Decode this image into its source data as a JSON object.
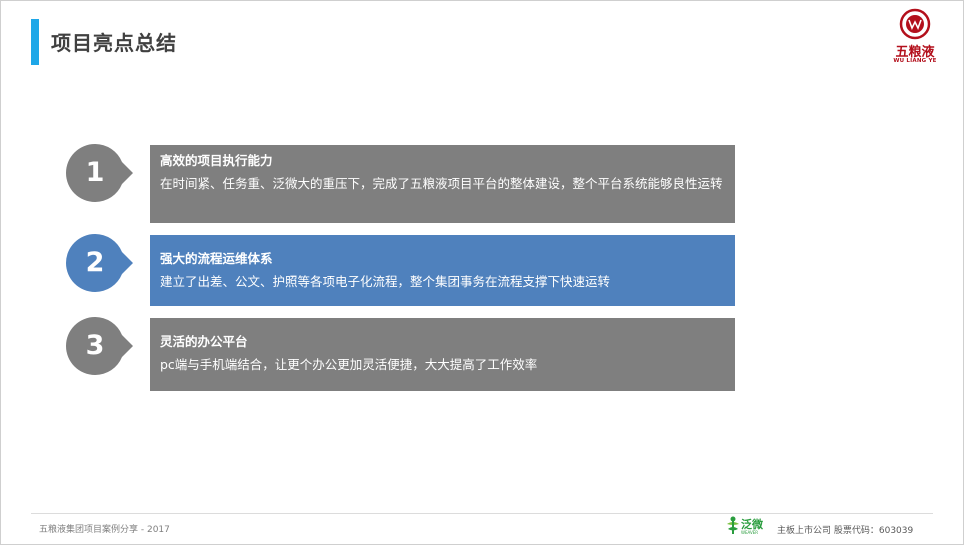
{
  "slide": {
    "title": "项目亮点总结"
  },
  "logo": {
    "text": "五粮液",
    "subtext": "WU LIANG YE",
    "color": "#b3101c"
  },
  "items": [
    {
      "number": "1",
      "heading": "高效的项目执行能力",
      "body": "在时间紧、任务重、泛微大的重压下，完成了五粮液项目平台的整体建设，整个平台系统能够良性运转",
      "color": "#7f7f7f"
    },
    {
      "number": "2",
      "heading": "强大的流程运维体系",
      "body": "建立了出差、公文、护照等各项电子化流程，整个集团事务在流程支撑下快速运转",
      "color": "#4f81bd"
    },
    {
      "number": "3",
      "heading": "灵活的办公平台",
      "body": "pc端与手机端结合，让更个办公更加灵活便捷，大大提高了工作效率",
      "color": "#7f7f7f"
    }
  ],
  "footer": {
    "left": "五粮液集团项目案例分享 - 2017",
    "brand": "泛微",
    "brand_sub": "WEAVER",
    "right": "主板上市公司  股票代码：603039"
  },
  "accent_color": "#1ea7e8"
}
